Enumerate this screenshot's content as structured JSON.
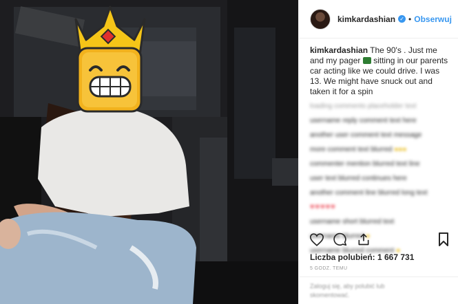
{
  "header": {
    "username": "kimkardashian",
    "verified_symbol": "✓",
    "separator": "•",
    "follow_label": "Obserwuj"
  },
  "caption": {
    "username": "kimkardashian",
    "text_before_emoji": "The 90's . Just me and my pager",
    "text_after_emoji": "sitting in our parents car acting like we could drive. I was 13. We might have snuck out and taken it for a spin"
  },
  "photo": {
    "face_overlay_icon": "king-grinning-emoji",
    "crown_color": "#f5c518",
    "face_color": "#f2b21d"
  },
  "likes": {
    "label": "Liczba polubień: 1 667 731"
  },
  "timestamp": "5 GODZ. TEMU",
  "icons": [
    "heart-icon",
    "comment-icon",
    "share-icon",
    "bookmark-icon"
  ],
  "colors": {
    "link": "#3897f0",
    "verified": "#3897f0",
    "hearts": "#ed4956"
  }
}
